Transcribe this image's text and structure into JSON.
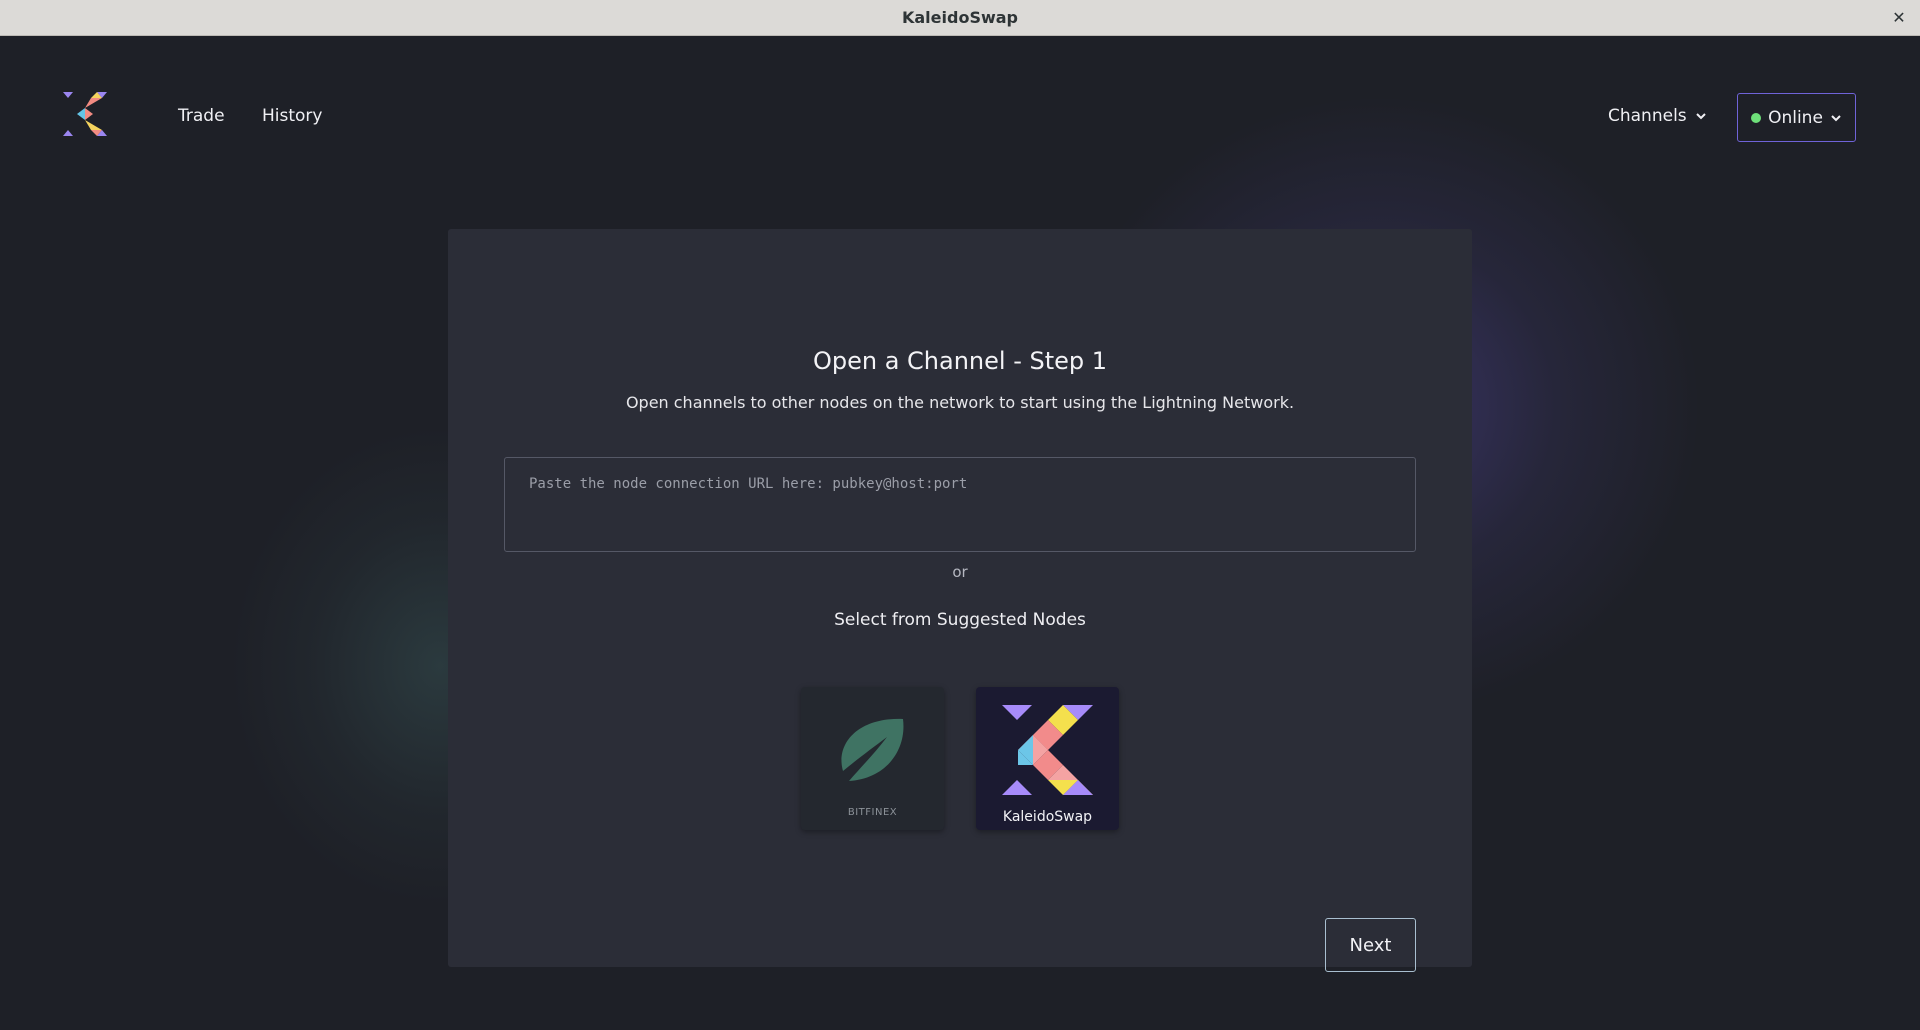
{
  "window": {
    "title": "KaleidoSwap",
    "close_glyph": "✕"
  },
  "nav": {
    "links": [
      {
        "label": "Trade"
      },
      {
        "label": "History"
      }
    ],
    "channels_label": "Channels",
    "status": {
      "label": "Online",
      "color": "#6ee07a"
    }
  },
  "open_channel": {
    "title": "Open a Channel - Step 1",
    "subtitle": "Open channels to other nodes on the network to start using the Lightning Network.",
    "input": {
      "placeholder": "Paste the node connection URL here: pubkey@host:port",
      "value": ""
    },
    "or_label": "or",
    "suggested_label": "Select from Suggested Nodes",
    "nodes": [
      {
        "name": "BITFINEX",
        "icon": "bitfinex-leaf-icon"
      },
      {
        "name": "KaleidoSwap",
        "icon": "kaleidoswap-logo-icon"
      }
    ],
    "next_label": "Next"
  },
  "colors": {
    "background": "#1e2027",
    "card": "#2b2d37",
    "accent": "#6f63d8",
    "online": "#6ee07a"
  }
}
